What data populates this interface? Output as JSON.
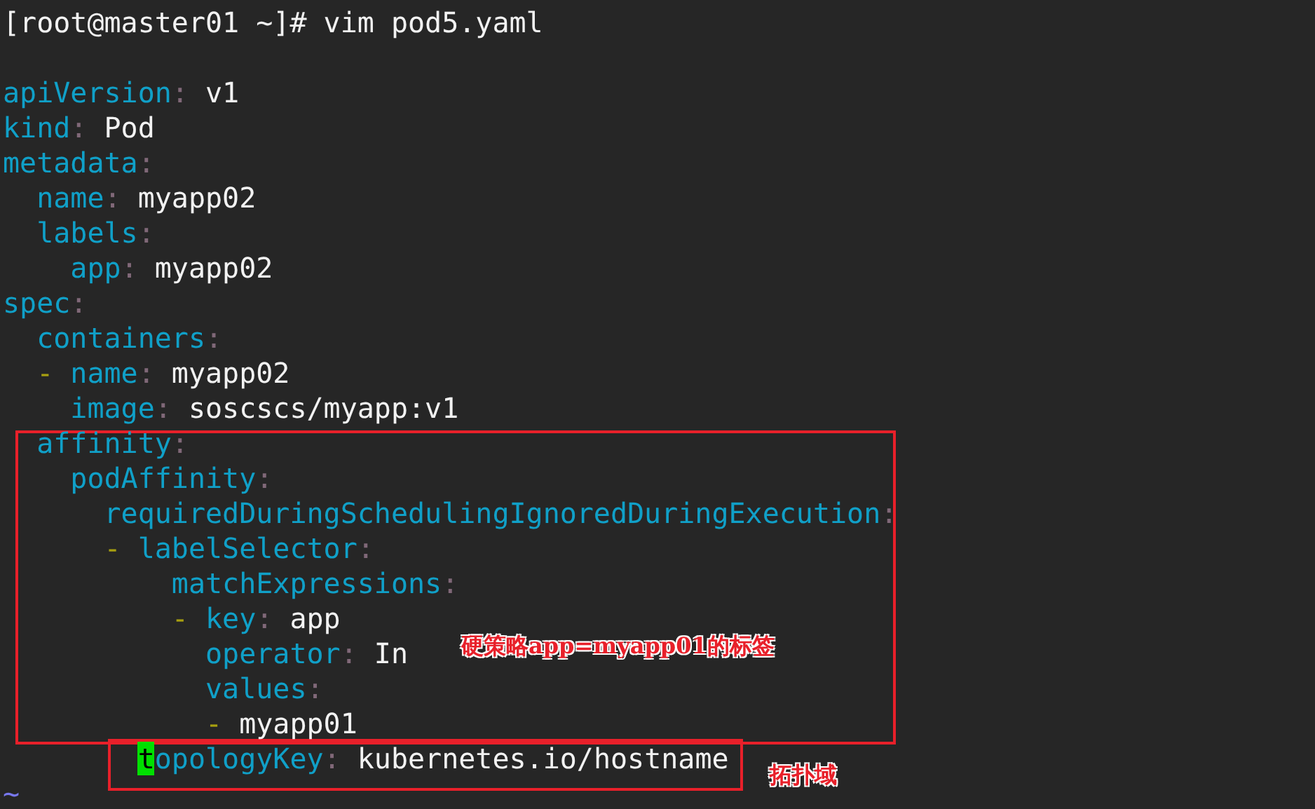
{
  "terminal": {
    "lines": [
      {
        "tokens": [
          {
            "kind": "plain",
            "text": "[root@master01 ~]# vim pod5.yaml"
          }
        ]
      },
      {
        "tokens": [
          {
            "kind": "key",
            "text": "apiVersion"
          },
          {
            "kind": "punct",
            "text": ":"
          },
          {
            "kind": "plain",
            "text": "v1"
          }
        ]
      },
      {
        "tokens": [
          {
            "kind": "key",
            "text": "kind"
          },
          {
            "kind": "punct",
            "text": ":"
          },
          {
            "kind": "plain",
            "text": "Pod"
          }
        ]
      },
      {
        "tokens": [
          {
            "kind": "key",
            "text": "metadata"
          },
          {
            "kind": "punct",
            "text": ":"
          }
        ]
      },
      {
        "tokens": [
          {
            "kind": "key",
            "text": "  name"
          },
          {
            "kind": "punct",
            "text": ":"
          },
          {
            "kind": "plain",
            "text": "myapp02"
          }
        ]
      },
      {
        "tokens": [
          {
            "kind": "key",
            "text": "  labels"
          },
          {
            "kind": "punct",
            "text": ":"
          }
        ]
      },
      {
        "tokens": [
          {
            "kind": "key",
            "text": "    app"
          },
          {
            "kind": "punct",
            "text": ":"
          },
          {
            "kind": "plain",
            "text": "myapp02"
          }
        ]
      },
      {
        "tokens": [
          {
            "kind": "key",
            "text": "spec"
          },
          {
            "kind": "punct",
            "text": ":"
          }
        ]
      },
      {
        "tokens": [
          {
            "kind": "key",
            "text": "  containers"
          },
          {
            "kind": "punct",
            "text": ":"
          }
        ]
      },
      {
        "tokens": [
          {
            "kind": "dash",
            "text": "  -"
          },
          {
            "kind": "key",
            "text": "name"
          },
          {
            "kind": "punct",
            "text": ":"
          },
          {
            "kind": "plain",
            "text": "myapp02"
          }
        ]
      },
      {
        "tokens": [
          {
            "kind": "key",
            "text": "    image"
          },
          {
            "kind": "punct",
            "text": ":"
          },
          {
            "kind": "plain",
            "text": "soscscs/myapp:v1"
          }
        ]
      },
      {
        "tokens": [
          {
            "kind": "key",
            "text": "  affinity"
          },
          {
            "kind": "punct",
            "text": ":"
          }
        ]
      },
      {
        "tokens": [
          {
            "kind": "key",
            "text": "    podAffinity"
          },
          {
            "kind": "punct",
            "text": ":"
          }
        ]
      },
      {
        "tokens": [
          {
            "kind": "key",
            "text": "      requiredDuringSchedulingIgnoredDuringExecution"
          },
          {
            "kind": "punct",
            "text": ":"
          }
        ]
      },
      {
        "tokens": [
          {
            "kind": "dash",
            "text": "      -"
          },
          {
            "kind": "key",
            "text": "labelSelector"
          },
          {
            "kind": "punct",
            "text": ":"
          }
        ]
      },
      {
        "tokens": [
          {
            "kind": "key",
            "text": "          matchExpressions"
          },
          {
            "kind": "punct",
            "text": ":"
          }
        ]
      },
      {
        "tokens": [
          {
            "kind": "dash",
            "text": "          -"
          },
          {
            "kind": "key",
            "text": "key"
          },
          {
            "kind": "punct",
            "text": ":"
          },
          {
            "kind": "plain",
            "text": "app"
          }
        ]
      },
      {
        "tokens": [
          {
            "kind": "key",
            "text": "            operator"
          },
          {
            "kind": "punct",
            "text": ":"
          },
          {
            "kind": "plain",
            "text": "In"
          }
        ]
      },
      {
        "tokens": [
          {
            "kind": "key",
            "text": "            values"
          },
          {
            "kind": "punct",
            "text": ":"
          }
        ]
      },
      {
        "tokens": [
          {
            "kind": "dash",
            "text": "            -"
          },
          {
            "kind": "plain",
            "text": "myapp01"
          }
        ]
      },
      {
        "tokens": [
          {
            "kind": "cursor",
            "text": "        t"
          },
          {
            "kind": "key",
            "text": "opologyKey"
          },
          {
            "kind": "punct",
            "text": ":"
          },
          {
            "kind": "plain",
            "text": "kubernetes.io/hostname"
          }
        ]
      },
      {
        "tokens": [
          {
            "kind": "tilde",
            "text": "~"
          }
        ]
      }
    ]
  },
  "annotations": [
    {
      "text": "硬策略app=myapp01的标签"
    },
    {
      "text": "拓扑域"
    }
  ]
}
